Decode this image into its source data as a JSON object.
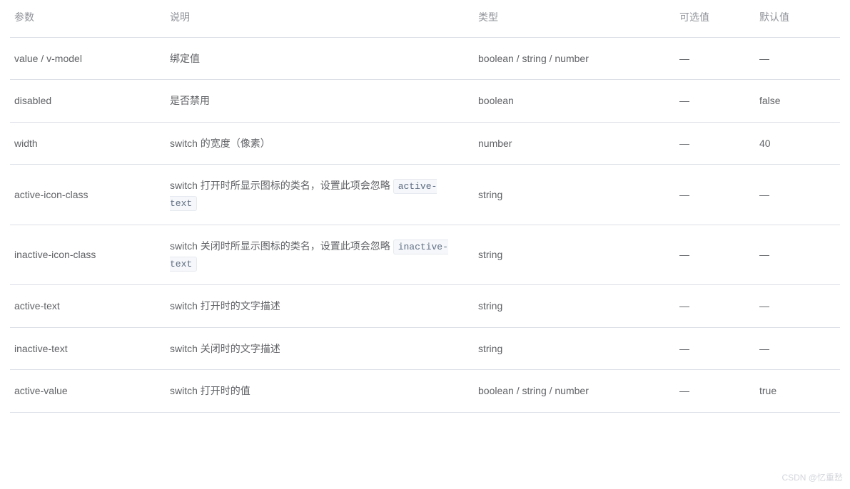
{
  "headers": {
    "param": "参数",
    "description": "说明",
    "type": "类型",
    "options": "可选值",
    "default": "默认值"
  },
  "rows": [
    {
      "param": "value / v-model",
      "desc_text": "绑定值",
      "desc_code": null,
      "type": "boolean / string / number",
      "options": "—",
      "default": "—"
    },
    {
      "param": "disabled",
      "desc_text": "是否禁用",
      "desc_code": null,
      "type": "boolean",
      "options": "—",
      "default": "false"
    },
    {
      "param": "width",
      "desc_text": "switch 的宽度（像素）",
      "desc_code": null,
      "type": "number",
      "options": "—",
      "default": "40"
    },
    {
      "param": "active-icon-class",
      "desc_text": "switch 打开时所显示图标的类名，设置此项会忽略 ",
      "desc_code": "active-text",
      "type": "string",
      "options": "—",
      "default": "—"
    },
    {
      "param": "inactive-icon-class",
      "desc_text": "switch 关闭时所显示图标的类名，设置此项会忽略 ",
      "desc_code": "inactive-text",
      "type": "string",
      "options": "—",
      "default": "—"
    },
    {
      "param": "active-text",
      "desc_text": "switch 打开时的文字描述",
      "desc_code": null,
      "type": "string",
      "options": "—",
      "default": "—"
    },
    {
      "param": "inactive-text",
      "desc_text": "switch 关闭时的文字描述",
      "desc_code": null,
      "type": "string",
      "options": "—",
      "default": "—"
    },
    {
      "param": "active-value",
      "desc_text": "switch 打开时的值",
      "desc_code": null,
      "type": "boolean / string / number",
      "options": "—",
      "default": "true"
    }
  ],
  "watermark": "CSDN @忆重愁"
}
